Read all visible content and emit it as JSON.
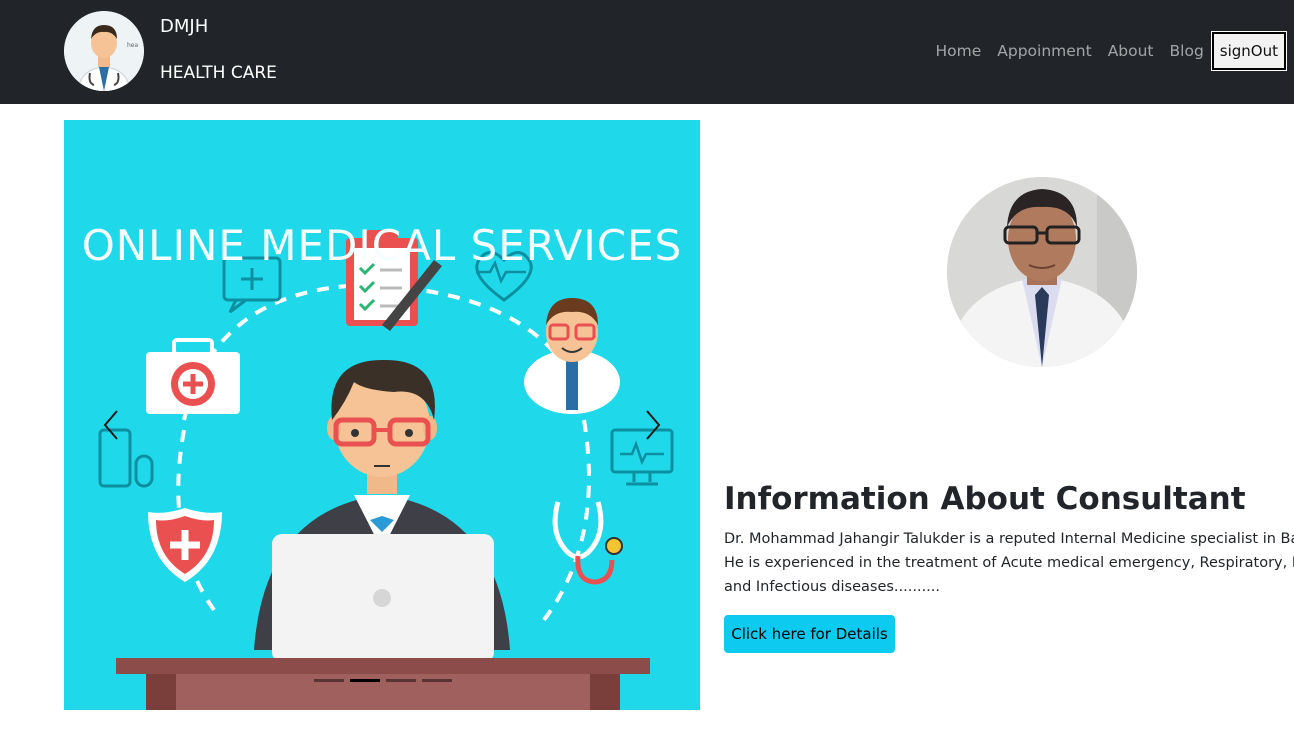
{
  "brand": {
    "title": "DMJH",
    "subtitle": "HEALTH CARE",
    "logo_icon": "doctor-avatar-icon"
  },
  "nav": {
    "links": [
      "Home",
      "Appoinment",
      "About",
      "Blog"
    ],
    "signout_label": "signOut"
  },
  "carousel": {
    "slide_title": "ONLINE MEDICAL SERVICES",
    "prev_icon": "chevron-left-icon",
    "next_icon": "chevron-right-icon",
    "slide_count": 4,
    "active_slide": 2
  },
  "consultant": {
    "photo_icon": "doctor-photo",
    "heading": "Information About Consultant",
    "lines": [
      "Dr. Mohammad Jahangir Talukder is a reputed Internal Medicine specialist in Bang",
      "He is experienced in the treatment of Acute medical emergency, Respiratory, End",
      "and Infectious diseases.........."
    ],
    "button_label": "Click here for Details"
  },
  "colors": {
    "navbar": "#212529",
    "carousel_bg": "#1fd9ea",
    "button": "#0dcaf0"
  }
}
